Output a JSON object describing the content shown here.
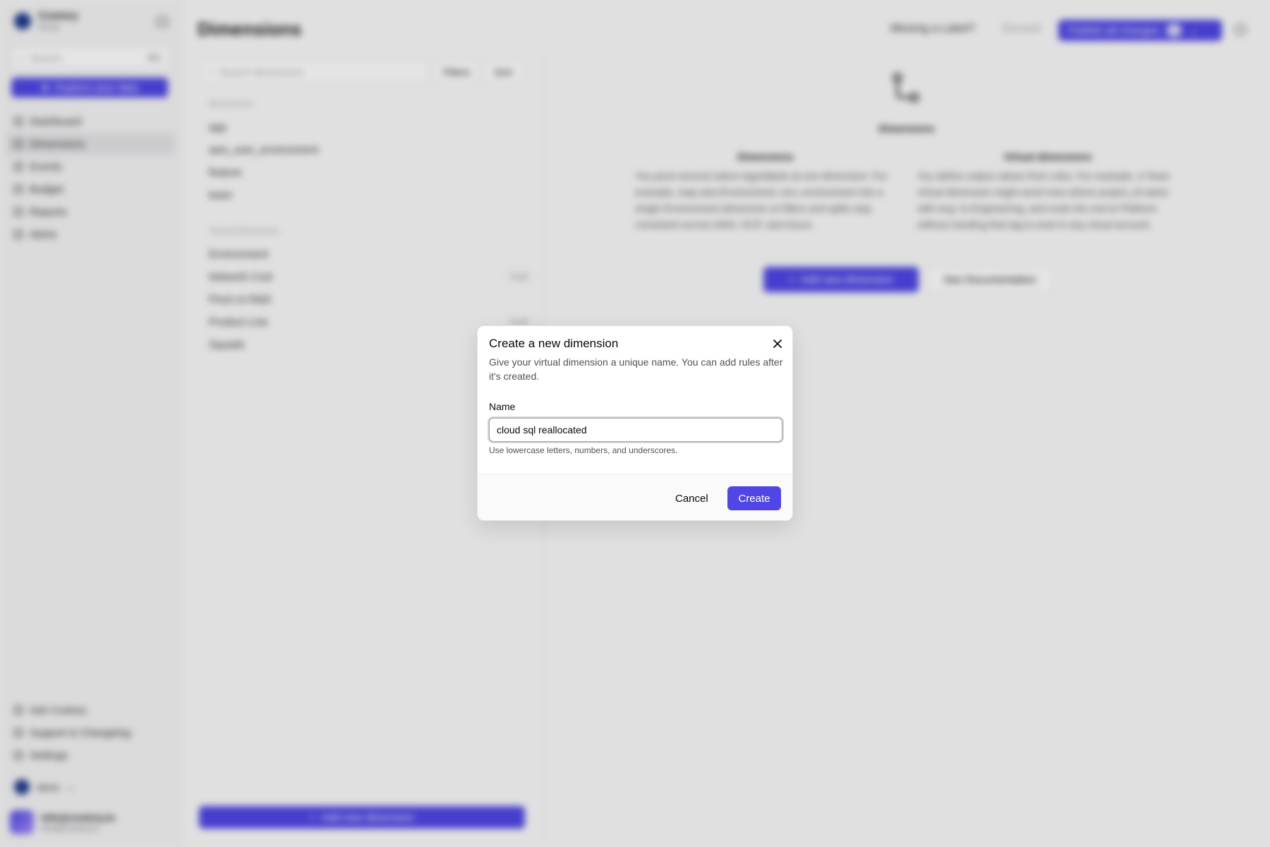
{
  "sidebar": {
    "brand_name": "Costory",
    "brand_sub": "Acme",
    "search_placeholder": "Search",
    "search_kbd": "⌘K",
    "explore_label": "Explore your data",
    "nav": [
      {
        "label": "Dashboard",
        "icon": "home-icon"
      },
      {
        "label": "Dimensions",
        "icon": "dimensions-icon"
      },
      {
        "label": "Events",
        "icon": "events-icon"
      },
      {
        "label": "Budget",
        "icon": "budget-icon"
      },
      {
        "label": "Reports",
        "icon": "reports-icon"
      },
      {
        "label": "Alerts",
        "icon": "alerts-icon"
      }
    ],
    "bottom_nav": [
      {
        "label": "Ask Costory"
      },
      {
        "label": "Support & Changelog"
      },
      {
        "label": "Settings"
      }
    ],
    "org_name": "demo",
    "user_name": "info@costory.io",
    "user_email": "info@costory.io"
  },
  "header": {
    "title": "Dimensions",
    "missing_label": "Missing a Label?",
    "discard_label": "Discard",
    "publish_label": "Publish all changes"
  },
  "list": {
    "search_placeholder": "Search dimensions",
    "filters_label": "Filters",
    "sort_label": "Sort",
    "dimensions_heading": "Dimensions",
    "dimensions": [
      "app",
      "aws_user_environment",
      "feature",
      "team"
    ],
    "virtual_heading": "Virtual Dimensions",
    "virtual": [
      {
        "label": "Environment",
        "badge": ""
      },
      {
        "label": "Network Cost",
        "badge": "Draft"
      },
      {
        "label": "Pivot vs R&D",
        "badge": ""
      },
      {
        "label": "Product Line",
        "badge": "Draft"
      },
      {
        "label": "Squads",
        "badge": ""
      }
    ],
    "add_label": "Add new dimension"
  },
  "empty_state": {
    "title": "Dimensions",
    "col1_title": "Dimensions",
    "col1_text": "You pivot several native tags/labels at one dimension. For example, map aws:Environment, env, environment into a single Environment dimension so filters and splits stay consistent across AWS, GCP, and Azure.",
    "col2_title": "Virtual dimensions",
    "col2_text": "You define output values from rules. For example, a Team virtual dimension might send rows where project_id starts with eng- to Engineering, and route the rest to Platform without needing that tag to exist in any cloud account.",
    "add_label": "Add new dimension",
    "docs_label": "See Documentation"
  },
  "modal": {
    "title": "Create a new dimension",
    "description": "Give your virtual dimension a unique name. You can add rules after it's created.",
    "field_label": "Name",
    "field_value": "cloud sql reallocated",
    "field_hint": "Use lowercase letters, numbers, and underscores.",
    "cancel_label": "Cancel",
    "create_label": "Create"
  },
  "colors": {
    "accent": "#4f46e5",
    "overlay": "rgba(0,0,0,0.1)"
  }
}
